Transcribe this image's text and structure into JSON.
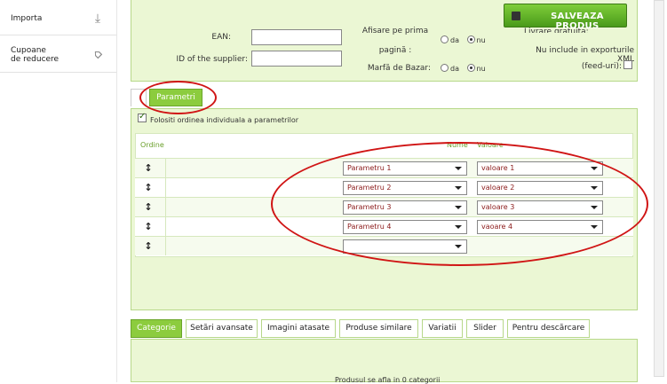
{
  "sidebar": {
    "items": [
      {
        "label": "Importa",
        "icon": "download-icon"
      },
      {
        "label": "Cupoane\nde reducere",
        "icon": "tag-icon"
      }
    ]
  },
  "product_form": {
    "ean_label": "EAN:",
    "ean_value": "",
    "supplier_label": "ID of the supplier:",
    "supplier_value": "",
    "homepage_label": "Afisare pe prima",
    "homepage_label2": "pagină :",
    "homepage_options": {
      "yes": "da",
      "no": "nu",
      "selected": "nu"
    },
    "bazaar_label": "Marfă de Bazar:",
    "bazaar_options": {
      "yes": "da",
      "no": "nu",
      "selected": "nu"
    },
    "free_delivery_label": "Livrare gratuita:",
    "exclude_export_label": "Nu include in exporturile XML",
    "exclude_export_label2": "(feed-uri):",
    "exclude_export_checked": false,
    "save_button": "SALVEAZA PRODUS"
  },
  "params_tab": {
    "label": "Parametri",
    "use_order_label": "Folositi ordinea individuala a parametrilor",
    "use_order_checked": true,
    "col_order": "Ordine",
    "col_name": "Nume",
    "col_value": "Valoare",
    "rows": [
      {
        "name": "Parametru 1",
        "value": "valoare 1"
      },
      {
        "name": "Parametru 2",
        "value": "valoare 2"
      },
      {
        "name": "Parametru 3",
        "value": "valoare 3"
      },
      {
        "name": "Parametru 4",
        "value": "vaoare 4"
      },
      {
        "name": "",
        "value": ""
      }
    ]
  },
  "bottom_tabs": {
    "tabs": [
      {
        "label": "Categorie",
        "active": true
      },
      {
        "label": "Setări avansate",
        "active": false
      },
      {
        "label": "Imagini atasate",
        "active": false
      },
      {
        "label": "Produse similare",
        "active": false
      },
      {
        "label": "Variatii",
        "active": false
      },
      {
        "label": "Slider",
        "active": false
      },
      {
        "label": "Pentru descărcare",
        "active": false
      }
    ],
    "category_status": "Produsul se afla in 0 categorii"
  },
  "colors": {
    "accent": "#8ccc3e",
    "panel": "#ebf7d4",
    "annotation": "#d01515"
  }
}
